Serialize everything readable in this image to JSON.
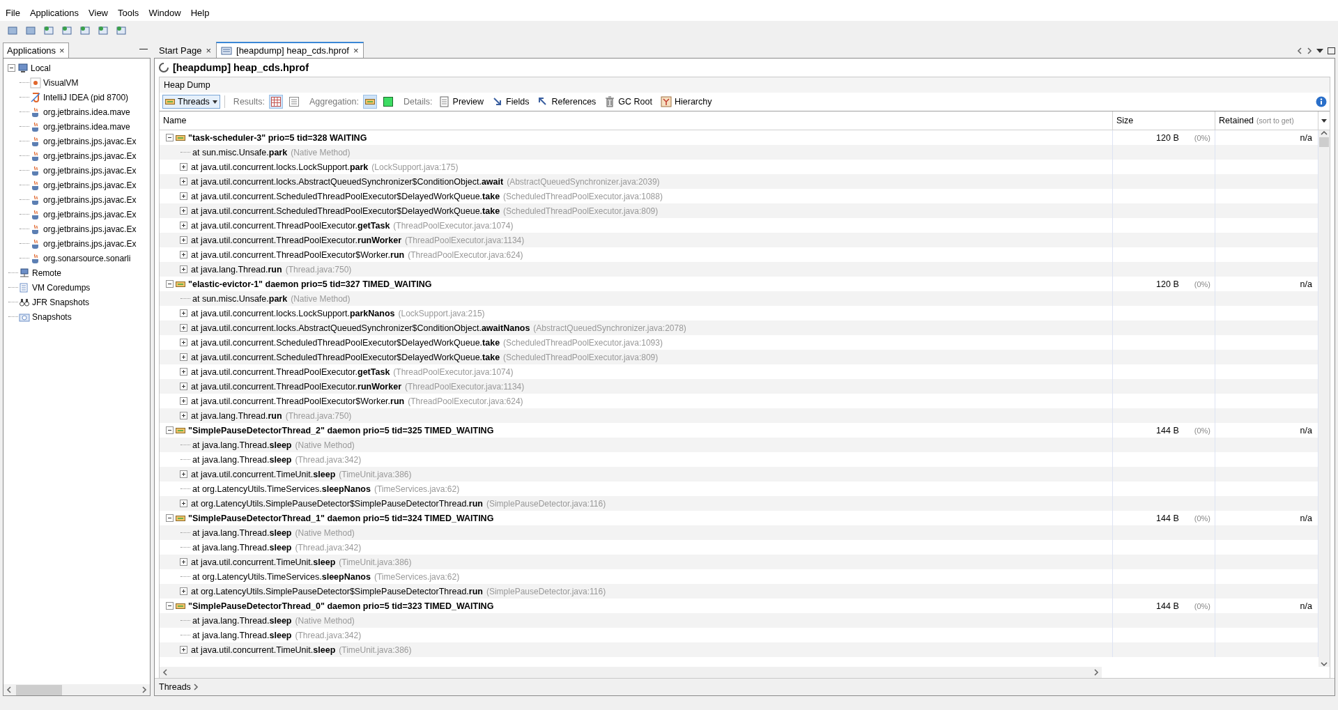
{
  "menu": [
    "File",
    "Applications",
    "View",
    "Tools",
    "Window",
    "Help"
  ],
  "sidebar": {
    "tab": {
      "label": "Applications",
      "close": "×"
    },
    "minimize": "—",
    "tree": [
      {
        "label": "Local",
        "kind": "computer",
        "expanded": true,
        "children": [
          {
            "label": "VisualVM",
            "kind": "visualvm"
          },
          {
            "label": "IntelliJ IDEA (pid 8700)",
            "kind": "idea"
          },
          {
            "label": "org.jetbrains.idea.mave",
            "kind": "java"
          },
          {
            "label": "org.jetbrains.idea.mave",
            "kind": "java"
          },
          {
            "label": "org.jetbrains.jps.javac.Ex",
            "kind": "java"
          },
          {
            "label": "org.jetbrains.jps.javac.Ex",
            "kind": "java"
          },
          {
            "label": "org.jetbrains.jps.javac.Ex",
            "kind": "java"
          },
          {
            "label": "org.jetbrains.jps.javac.Ex",
            "kind": "java"
          },
          {
            "label": "org.jetbrains.jps.javac.Ex",
            "kind": "java"
          },
          {
            "label": "org.jetbrains.jps.javac.Ex",
            "kind": "java"
          },
          {
            "label": "org.jetbrains.jps.javac.Ex",
            "kind": "java"
          },
          {
            "label": "org.jetbrains.jps.javac.Ex",
            "kind": "java"
          },
          {
            "label": "org.sonarsource.sonarli",
            "kind": "java"
          }
        ]
      },
      {
        "label": "Remote",
        "kind": "remote"
      },
      {
        "label": "VM Coredumps",
        "kind": "coredump"
      },
      {
        "label": "JFR Snapshots",
        "kind": "jfr"
      },
      {
        "label": "Snapshots",
        "kind": "snapshot"
      }
    ]
  },
  "tabs": [
    {
      "label": "Start Page",
      "close": "×",
      "selected": false
    },
    {
      "label": "[heapdump] heap_cds.hprof",
      "close": "×",
      "selected": true
    }
  ],
  "document": {
    "title": "[heapdump] heap_cds.hprof",
    "section": "Heap Dump",
    "toolbar": {
      "view": "Threads",
      "results_label": "Results:",
      "results": [
        {
          "kind": "table",
          "selected": true
        },
        {
          "kind": "list",
          "selected": false
        }
      ],
      "aggregation_label": "Aggregation:",
      "aggregation": [
        {
          "kind": "bar",
          "selected": true
        },
        {
          "kind": "square",
          "selected": false
        }
      ],
      "details_label": "Details:",
      "details": [
        {
          "label": "Preview",
          "kind": "preview"
        },
        {
          "label": "Fields",
          "kind": "fields"
        },
        {
          "label": "References",
          "kind": "references"
        },
        {
          "label": "GC Root",
          "kind": "gcroot"
        },
        {
          "label": "Hierarchy",
          "kind": "hierarchy"
        }
      ]
    },
    "table": {
      "columns": [
        {
          "label": "Name"
        },
        {
          "label": "Size"
        },
        {
          "label": "Retained",
          "hint": "(sort to get)"
        }
      ],
      "threads": [
        {
          "name": "\"task-scheduler-3\" prio=5 tid=328 WAITING",
          "expanded": true,
          "size": "120 B",
          "percent": "(0%)",
          "retained": "n/a",
          "frames": [
            {
              "text": "at sun.misc.Unsafe.**park**",
              "location": "(Native Method)",
              "expandable": false
            },
            {
              "text": "at java.util.concurrent.locks.LockSupport.**park**",
              "location": "(LockSupport.java:175)",
              "expandable": true
            },
            {
              "text": "at java.util.concurrent.locks.AbstractQueuedSynchronizer$ConditionObject.**await**",
              "location": "(AbstractQueuedSynchronizer.java:2039)",
              "expandable": true
            },
            {
              "text": "at java.util.concurrent.ScheduledThreadPoolExecutor$DelayedWorkQueue.**take**",
              "location": "(ScheduledThreadPoolExecutor.java:1088)",
              "expandable": true
            },
            {
              "text": "at java.util.concurrent.ScheduledThreadPoolExecutor$DelayedWorkQueue.**take**",
              "location": "(ScheduledThreadPoolExecutor.java:809)",
              "expandable": true
            },
            {
              "text": "at java.util.concurrent.ThreadPoolExecutor.**getTask**",
              "location": "(ThreadPoolExecutor.java:1074)",
              "expandable": true
            },
            {
              "text": "at java.util.concurrent.ThreadPoolExecutor.**runWorker**",
              "location": "(ThreadPoolExecutor.java:1134)",
              "expandable": true
            },
            {
              "text": "at java.util.concurrent.ThreadPoolExecutor$Worker.**run**",
              "location": "(ThreadPoolExecutor.java:624)",
              "expandable": true
            },
            {
              "text": "at java.lang.Thread.**run**",
              "location": "(Thread.java:750)",
              "expandable": true
            }
          ]
        },
        {
          "name": "\"elastic-evictor-1\" daemon prio=5 tid=327 TIMED_WAITING",
          "expanded": true,
          "size": "120 B",
          "percent": "(0%)",
          "retained": "n/a",
          "frames": [
            {
              "text": "at sun.misc.Unsafe.**park**",
              "location": "(Native Method)",
              "expandable": false
            },
            {
              "text": "at java.util.concurrent.locks.LockSupport.**parkNanos**",
              "location": "(LockSupport.java:215)",
              "expandable": true
            },
            {
              "text": "at java.util.concurrent.locks.AbstractQueuedSynchronizer$ConditionObject.**awaitNanos**",
              "location": "(AbstractQueuedSynchronizer.java:2078)",
              "expandable": true
            },
            {
              "text": "at java.util.concurrent.ScheduledThreadPoolExecutor$DelayedWorkQueue.**take**",
              "location": "(ScheduledThreadPoolExecutor.java:1093)",
              "expandable": true
            },
            {
              "text": "at java.util.concurrent.ScheduledThreadPoolExecutor$DelayedWorkQueue.**take**",
              "location": "(ScheduledThreadPoolExecutor.java:809)",
              "expandable": true
            },
            {
              "text": "at java.util.concurrent.ThreadPoolExecutor.**getTask**",
              "location": "(ThreadPoolExecutor.java:1074)",
              "expandable": true
            },
            {
              "text": "at java.util.concurrent.ThreadPoolExecutor.**runWorker**",
              "location": "(ThreadPoolExecutor.java:1134)",
              "expandable": true
            },
            {
              "text": "at java.util.concurrent.ThreadPoolExecutor$Worker.**run**",
              "location": "(ThreadPoolExecutor.java:624)",
              "expandable": true
            },
            {
              "text": "at java.lang.Thread.**run**",
              "location": "(Thread.java:750)",
              "expandable": true
            }
          ]
        },
        {
          "name": "\"SimplePauseDetectorThread_2\" daemon prio=5 tid=325 TIMED_WAITING",
          "expanded": true,
          "size": "144 B",
          "percent": "(0%)",
          "retained": "n/a",
          "frames": [
            {
              "text": "at java.lang.Thread.**sleep**",
              "location": "(Native Method)",
              "expandable": false
            },
            {
              "text": "at java.lang.Thread.**sleep**",
              "location": "(Thread.java:342)",
              "expandable": false
            },
            {
              "text": "at java.util.concurrent.TimeUnit.**sleep**",
              "location": "(TimeUnit.java:386)",
              "expandable": true
            },
            {
              "text": "at org.LatencyUtils.TimeServices.**sleepNanos**",
              "location": "(TimeServices.java:62)",
              "expandable": false
            },
            {
              "text": "at org.LatencyUtils.SimplePauseDetector$SimplePauseDetectorThread.**run**",
              "location": "(SimplePauseDetector.java:116)",
              "expandable": true
            }
          ]
        },
        {
          "name": "\"SimplePauseDetectorThread_1\" daemon prio=5 tid=324 TIMED_WAITING",
          "expanded": true,
          "size": "144 B",
          "percent": "(0%)",
          "retained": "n/a",
          "frames": [
            {
              "text": "at java.lang.Thread.**sleep**",
              "location": "(Native Method)",
              "expandable": false
            },
            {
              "text": "at java.lang.Thread.**sleep**",
              "location": "(Thread.java:342)",
              "expandable": false
            },
            {
              "text": "at java.util.concurrent.TimeUnit.**sleep**",
              "location": "(TimeUnit.java:386)",
              "expandable": true
            },
            {
              "text": "at org.LatencyUtils.TimeServices.**sleepNanos**",
              "location": "(TimeServices.java:62)",
              "expandable": false
            },
            {
              "text": "at org.LatencyUtils.SimplePauseDetector$SimplePauseDetectorThread.**run**",
              "location": "(SimplePauseDetector.java:116)",
              "expandable": true
            }
          ]
        },
        {
          "name": "\"SimplePauseDetectorThread_0\" daemon prio=5 tid=323 TIMED_WAITING",
          "expanded": true,
          "size": "144 B",
          "percent": "(0%)",
          "retained": "n/a",
          "frames": [
            {
              "text": "at java.lang.Thread.**sleep**",
              "location": "(Native Method)",
              "expandable": false
            },
            {
              "text": "at java.lang.Thread.**sleep**",
              "location": "(Thread.java:342)",
              "expandable": false
            },
            {
              "text": "at java.util.concurrent.TimeUnit.**sleep**",
              "location": "(TimeUnit.java:386)",
              "expandable": true
            }
          ]
        }
      ]
    },
    "breadcrumb": "Threads"
  }
}
